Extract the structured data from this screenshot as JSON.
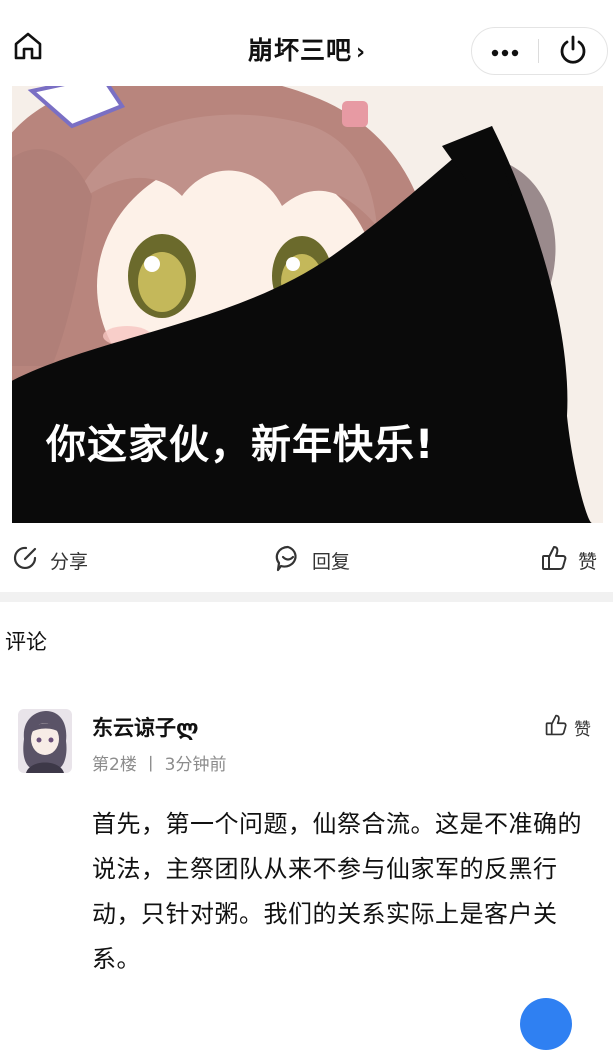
{
  "header": {
    "title": "崩坏三吧",
    "title_chevron": "›",
    "home_icon": "home-icon",
    "more_icon": "more-dots-icon",
    "power_icon": "power-icon"
  },
  "post_image": {
    "caption": "你这家伙，新年快乐!"
  },
  "actions": {
    "share_label": "分享",
    "reply_label": "回复",
    "like_label": "赞"
  },
  "comments_section": {
    "heading": "评论",
    "comments": [
      {
        "username": "东云谅子ლ",
        "floor": "第2楼",
        "separator": "丨",
        "time": "3分钟前",
        "like_label": "赞",
        "body": "首先，第一个问题，仙祭合流。这是不准确的说法，主祭团队从来不参与仙家军的反黑行动，只针对粥。我们的关系实际上是客户关系。"
      }
    ]
  },
  "colors": {
    "accent": "#2f80f2",
    "meta_text": "#8c8c8c",
    "divider": "#f1f1f1"
  }
}
